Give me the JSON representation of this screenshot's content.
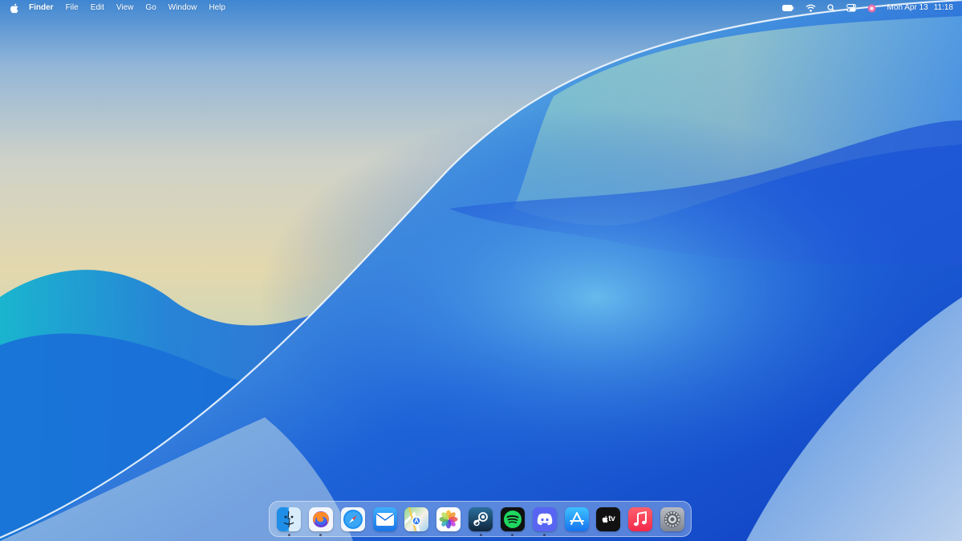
{
  "menubar": {
    "apple_icon": "apple-logo-icon",
    "app_name": "Finder",
    "menus": [
      "File",
      "Edit",
      "View",
      "Go",
      "Window",
      "Help"
    ],
    "status_icons": [
      "battery-icon",
      "wifi-icon",
      "search-icon",
      "control-center-icon",
      "siri-icon"
    ],
    "date": "Mon Apr 13",
    "time": "11:18"
  },
  "dock": {
    "apps": [
      {
        "name": "Finder",
        "icon": "finder-icon",
        "running": true
      },
      {
        "name": "Firefox",
        "icon": "firefox-icon",
        "running": true
      },
      {
        "name": "Safari",
        "icon": "safari-icon",
        "running": false
      },
      {
        "name": "Mail",
        "icon": "mail-icon",
        "running": false
      },
      {
        "name": "Maps",
        "icon": "maps-icon",
        "running": false
      },
      {
        "name": "Photos",
        "icon": "photos-icon",
        "running": false
      },
      {
        "name": "Steam",
        "icon": "steam-icon",
        "running": true
      },
      {
        "name": "Spotify",
        "icon": "spotify-icon",
        "running": true
      },
      {
        "name": "Discord",
        "icon": "discord-icon",
        "running": true
      },
      {
        "name": "App Store",
        "icon": "app-store-icon",
        "running": false
      },
      {
        "name": "Apple TV",
        "icon": "apple-tv-icon",
        "running": false
      },
      {
        "name": "Music",
        "icon": "music-icon",
        "running": false
      },
      {
        "name": "System Settings",
        "icon": "settings-icon",
        "running": false
      }
    ],
    "tv_label": "tv"
  },
  "colors": {
    "wallpaper_sky": "#e4d9b0",
    "wallpaper_blue": "#1656d4",
    "menubar_text": "#ffffff"
  }
}
